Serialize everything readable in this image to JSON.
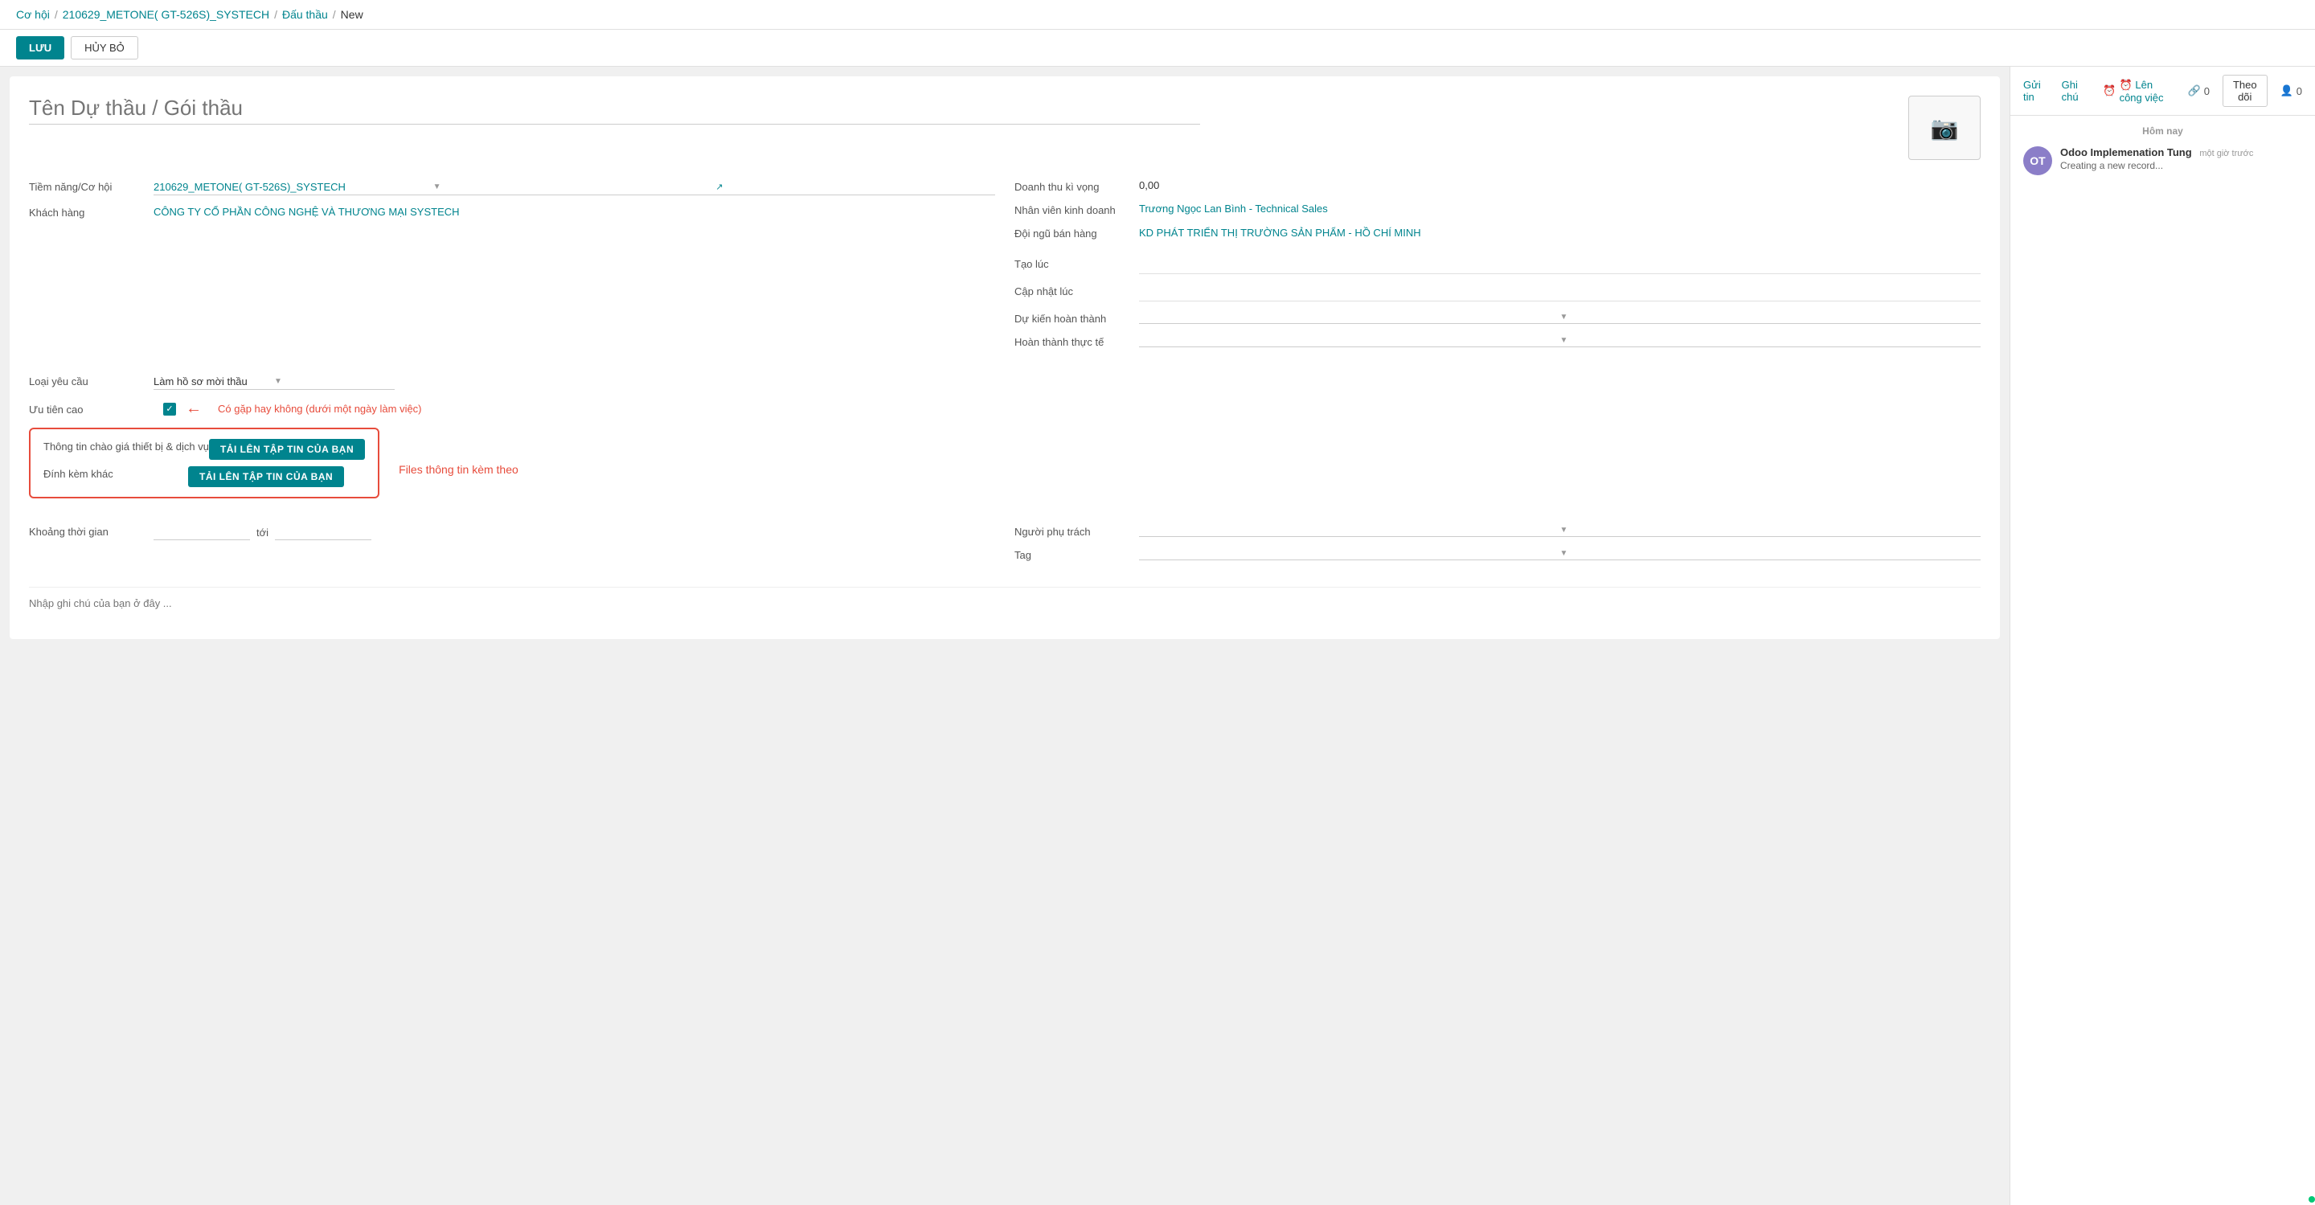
{
  "breadcrumb": {
    "part1": "Cơ hội",
    "sep1": "/",
    "part2": "210629_METONE( GT-526S)_SYSTECH",
    "sep2": "/",
    "part3": "Đấu thầu",
    "sep3": "/",
    "part4": "New"
  },
  "actions": {
    "save_label": "LƯU",
    "cancel_label": "HỦY BỎ"
  },
  "form": {
    "title_placeholder": "Tên Dự thầu / Gói thầu",
    "photo_icon": "📷",
    "fields_left": [
      {
        "label": "Tiềm năng/Cơ hội",
        "value": "210629_METONE( GT-526S)_SYSTECH",
        "type": "link-with-external"
      },
      {
        "label": "Khách hàng",
        "value": "CÔNG TY CỔ PHẦN CÔNG NGHỆ VÀ THƯƠNG MẠI SYSTECH",
        "type": "link"
      }
    ],
    "fields_right": [
      {
        "label": "Doanh thu kì vọng",
        "value": "0,00",
        "type": "black"
      },
      {
        "label": "Nhân viên kinh doanh",
        "value": "Trương Ngọc Lan Bình - Technical Sales",
        "type": "link"
      },
      {
        "label": "Đội ngũ bán hàng",
        "value": "KD PHÁT TRIỂN THỊ TRƯỜNG SẢN PHẨM - HỒ CHÍ MINH",
        "type": "link"
      }
    ],
    "fields_right2": [
      {
        "label": "Tạo lúc",
        "value": "",
        "type": "empty"
      },
      {
        "label": "Cập nhật lúc",
        "value": "",
        "type": "empty"
      },
      {
        "label": "Dự kiến hoàn thành",
        "value": "",
        "type": "dropdown"
      },
      {
        "label": "Hoàn thành thực tế",
        "value": "",
        "type": "dropdown"
      }
    ],
    "loai_yeu_cau_label": "Loại yêu cầu",
    "loai_yeu_cau_value": "Làm hồ sơ mời thầu",
    "uu_tien_cao_label": "Ưu tiên cao",
    "checkbox_checked": true,
    "co_gap_note": "Có gặp hay không (dưới một ngày làm việc)",
    "upload_section": {
      "row1_label": "Thông tin chào giá thiết bị & dịch vụ",
      "row1_btn": "TẢI LÊN TẬP TIN CỦA BẠN",
      "row2_label": "Đính kèm khác",
      "row2_btn": "TẢI LÊN TẬP TIN CỦA BẠN",
      "files_note": "Files thông tin kèm theo"
    },
    "khoang_thoi_gian_label": "Khoảng thời gian",
    "to_label": "tới",
    "nguoi_phu_trach_label": "Người phụ trách",
    "tag_label": "Tag",
    "notes_placeholder": "Nhập ghi chú của bạn ở đây ..."
  },
  "chatter": {
    "tabs": [
      {
        "label": "Gửi tin"
      },
      {
        "label": "Ghi chú"
      },
      {
        "label": "⏰ Lên công việc"
      }
    ],
    "icons": {
      "paperclip": "🔗",
      "paperclip_count": "0",
      "theo_doi": "Theo dõi",
      "user_icon": "👤",
      "user_count": "0"
    },
    "today_label": "Hôm nay",
    "messages": [
      {
        "avatar_initials": "OT",
        "avatar_color": "#8b7ec8",
        "author": "Odoo Implemenation Tung",
        "time": "một giờ trước",
        "text": "Creating a new record..."
      }
    ]
  }
}
